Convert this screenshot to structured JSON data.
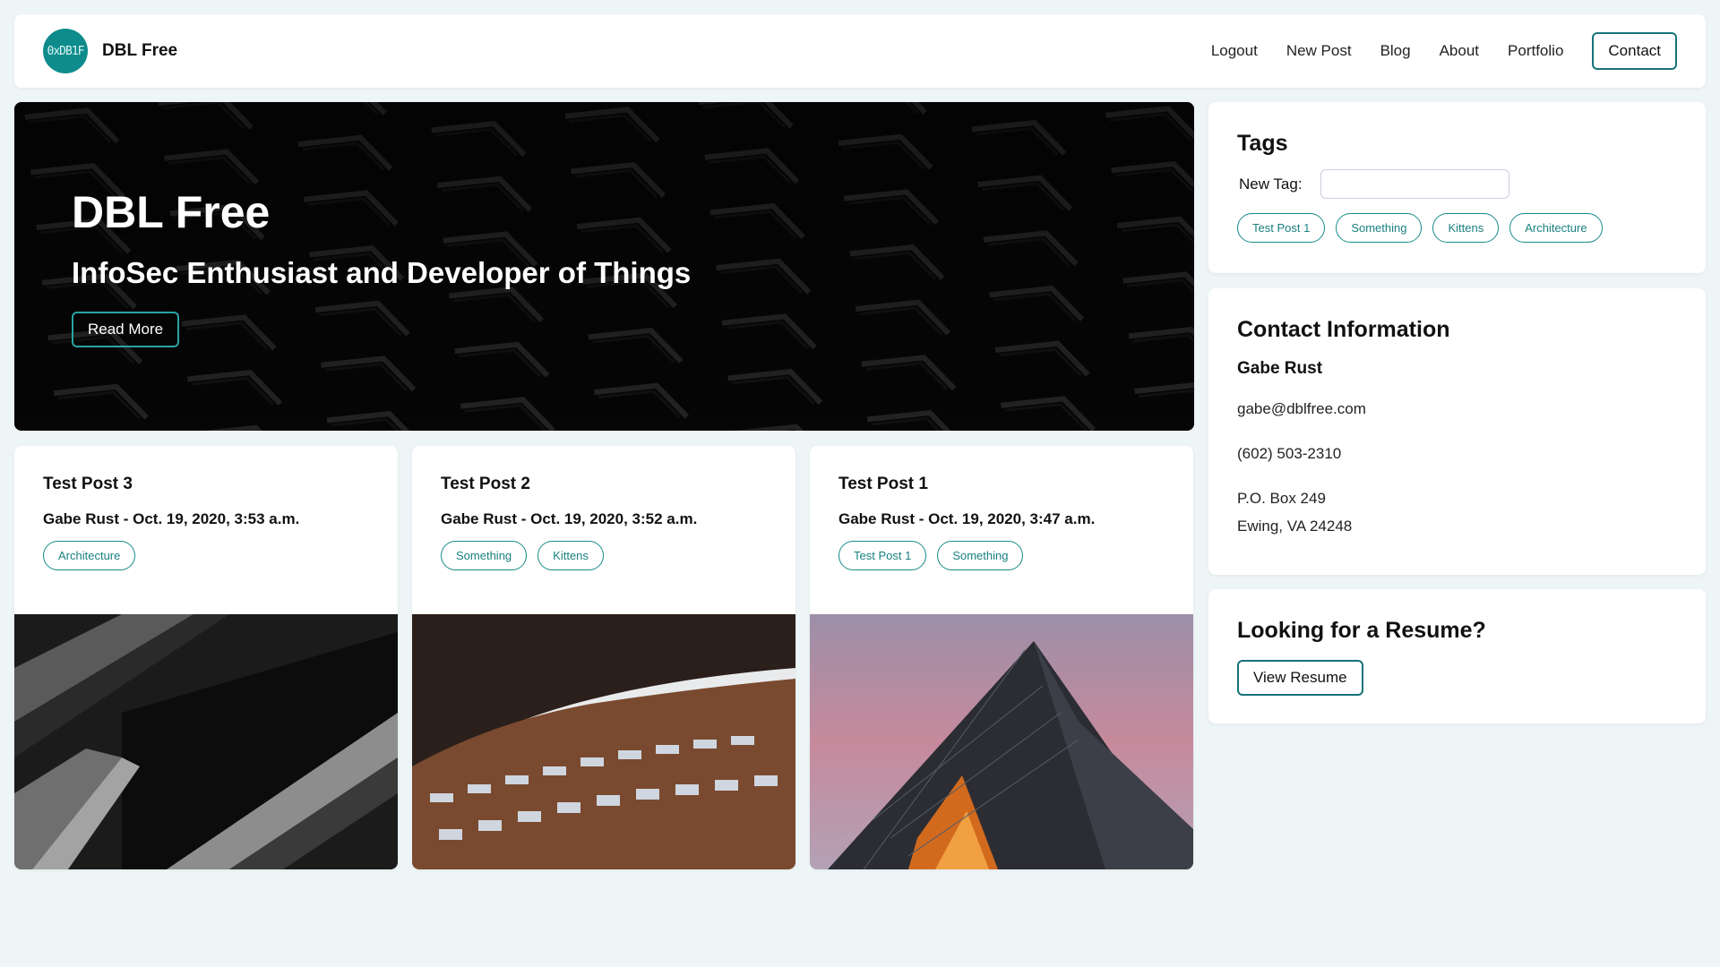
{
  "nav": {
    "logo_text": "0xDB1F",
    "brand": "DBL Free",
    "links": [
      "Logout",
      "New Post",
      "Blog",
      "About",
      "Portfolio"
    ],
    "contact_button": "Contact"
  },
  "hero": {
    "title": "DBL Free",
    "subtitle": "InfoSec Enthusiast and Developer of Things",
    "button": "Read More"
  },
  "posts": [
    {
      "title": "Test Post 3",
      "meta": "Gabe Rust - Oct. 19, 2020, 3:53 a.m.",
      "tags": [
        "Architecture"
      ]
    },
    {
      "title": "Test Post 2",
      "meta": "Gabe Rust - Oct. 19, 2020, 3:52 a.m.",
      "tags": [
        "Something",
        "Kittens"
      ]
    },
    {
      "title": "Test Post 1",
      "meta": "Gabe Rust - Oct. 19, 2020, 3:47 a.m.",
      "tags": [
        "Test Post 1",
        "Something"
      ]
    }
  ],
  "tags_panel": {
    "title": "Tags",
    "new_tag_label": "New Tag:",
    "new_tag_value": "",
    "tags": [
      "Test Post 1",
      "Something",
      "Kittens",
      "Architecture"
    ]
  },
  "contact": {
    "title": "Contact Information",
    "name": "Gabe Rust",
    "email": "gabe@dblfree.com",
    "phone": "(602) 503-2310",
    "address_line1": "P.O. Box 249",
    "address_line2": "Ewing, VA 24248"
  },
  "resume": {
    "title": "Looking for a Resume?",
    "button": "View Resume"
  },
  "colors": {
    "accent": "#16737a",
    "logo_bg": "#0e8c8c",
    "page_bg": "#eef5f7"
  }
}
